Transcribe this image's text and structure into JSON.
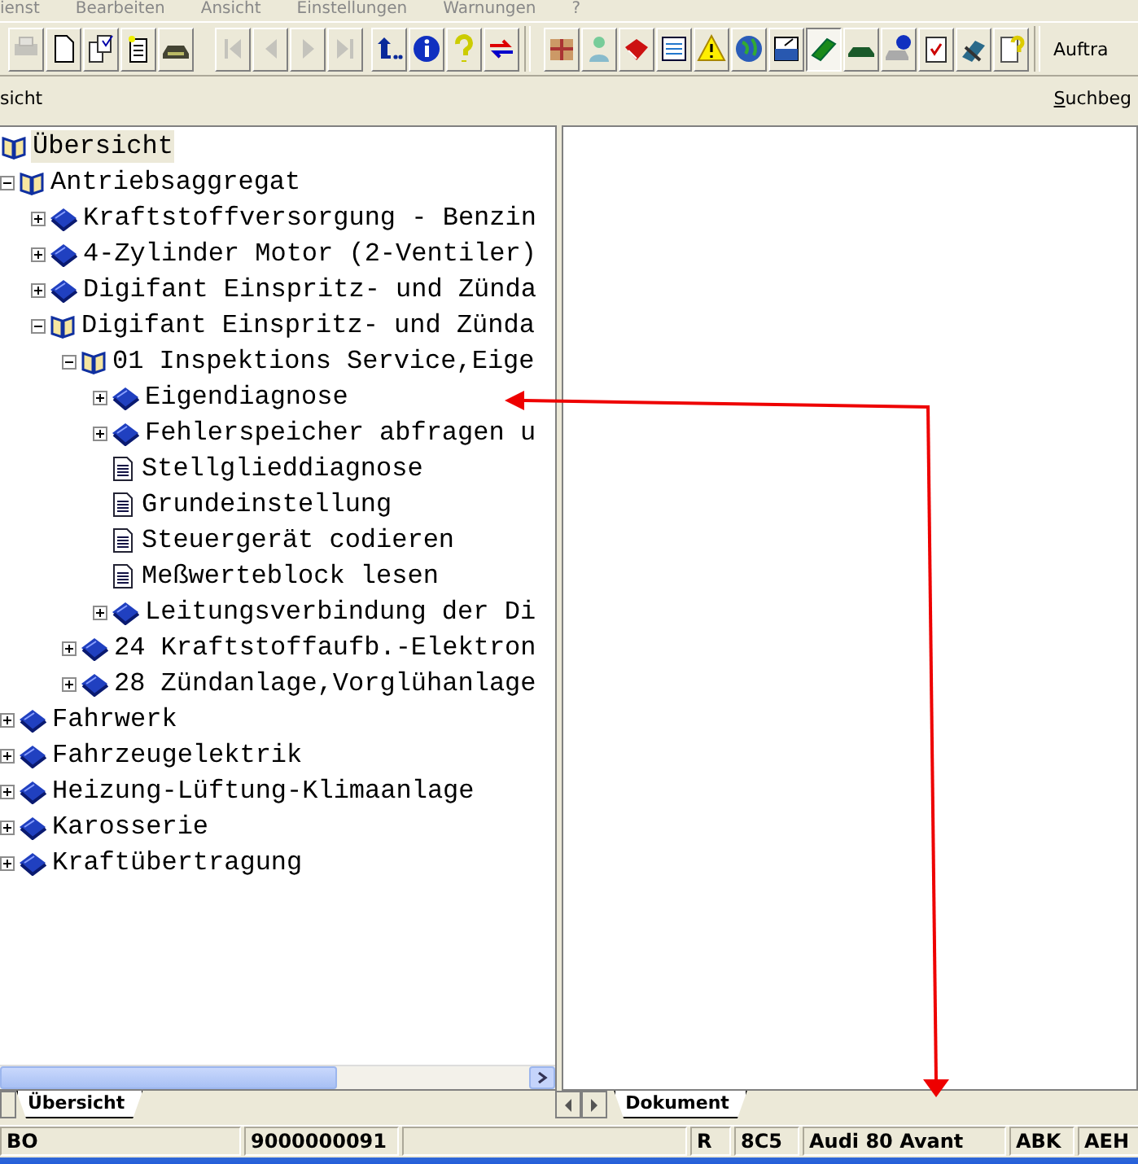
{
  "menu": [
    "ienst",
    "Bearbeiten",
    "Ansicht",
    "Einstellungen",
    "Warnungen",
    "?"
  ],
  "toolbar": {
    "groups": [
      [
        {
          "disabled": true,
          "pressed": false
        },
        {
          "disabled": false,
          "pressed": false
        },
        {
          "disabled": false,
          "pressed": false
        },
        {
          "disabled": false,
          "pressed": false
        },
        {
          "disabled": false,
          "pressed": false
        }
      ],
      [
        {
          "disabled": true,
          "pressed": false
        },
        {
          "disabled": true,
          "pressed": false
        },
        {
          "disabled": true,
          "pressed": false
        },
        {
          "disabled": true,
          "pressed": false
        }
      ],
      [
        {
          "disabled": false,
          "pressed": false
        },
        {
          "disabled": false,
          "pressed": false
        },
        {
          "disabled": false,
          "pressed": false
        },
        {
          "disabled": false,
          "pressed": false
        }
      ],
      [
        {
          "disabled": false,
          "pressed": false
        },
        {
          "disabled": false,
          "pressed": false
        },
        {
          "disabled": false,
          "pressed": false
        },
        {
          "disabled": false,
          "pressed": false
        },
        {
          "disabled": false,
          "pressed": false
        },
        {
          "disabled": false,
          "pressed": false
        },
        {
          "disabled": false,
          "pressed": false
        },
        {
          "disabled": false,
          "pressed": true
        },
        {
          "disabled": false,
          "pressed": false
        },
        {
          "disabled": false,
          "pressed": false
        },
        {
          "disabled": false,
          "pressed": false
        },
        {
          "disabled": false,
          "pressed": false
        },
        {
          "disabled": false,
          "pressed": false
        }
      ]
    ],
    "label": "Auftra"
  },
  "subbar": {
    "left": "sicht",
    "search_label": "Suchbeg"
  },
  "tree": [
    {
      "label": "Übersicht",
      "kind": "root",
      "selected": true
    },
    {
      "label": "Antriebsaggregat",
      "kind": "book",
      "expanded": true,
      "selected": false,
      "children": [
        {
          "label": "Kraftstoffversorgung - Benzin",
          "kind": "book",
          "expanded": false,
          "selected": false
        },
        {
          "label": "4-Zylinder Motor (2-Ventiler)",
          "kind": "book",
          "expanded": false,
          "selected": false
        },
        {
          "label": "Digifant Einspritz- und Zünda",
          "kind": "book",
          "expanded": false,
          "selected": false
        },
        {
          "label": "Digifant Einspritz- und Zünda",
          "kind": "book",
          "expanded": true,
          "selected": false,
          "children": [
            {
              "label": "01 Inspektions Service,Eige",
              "kind": "book",
              "expanded": true,
              "selected": false,
              "children": [
                {
                  "label": "Eigendiagnose",
                  "kind": "book",
                  "expanded": false,
                  "selected": false
                },
                {
                  "label": "Fehlerspeicher abfragen u",
                  "kind": "book",
                  "expanded": false,
                  "selected": false
                },
                {
                  "label": "Stellglieddiagnose",
                  "kind": "page",
                  "selected": false
                },
                {
                  "label": "Grundeinstellung",
                  "kind": "page",
                  "selected": false
                },
                {
                  "label": "Steuergerät codieren",
                  "kind": "page",
                  "selected": false
                },
                {
                  "label": "Meßwerteblock lesen",
                  "kind": "page",
                  "selected": false
                },
                {
                  "label": "Leitungsverbindung der Di",
                  "kind": "book",
                  "expanded": false,
                  "selected": false
                }
              ]
            },
            {
              "label": "24 Kraftstoffaufb.-Elektron",
              "kind": "book",
              "expanded": false,
              "selected": false
            },
            {
              "label": "28 Zündanlage,Vorglühanlage",
              "kind": "book",
              "expanded": false,
              "selected": false
            }
          ]
        }
      ]
    },
    {
      "label": "Fahrwerk",
      "kind": "book",
      "expanded": false,
      "selected": false
    },
    {
      "label": "Fahrzeugelektrik",
      "kind": "book",
      "expanded": false,
      "selected": false
    },
    {
      "label": "Heizung-Lüftung-Klimaanlage",
      "kind": "book",
      "expanded": false,
      "selected": false
    },
    {
      "label": "Karosserie",
      "kind": "book",
      "expanded": false,
      "selected": false
    },
    {
      "label": "Kraftübertragung",
      "kind": "book",
      "expanded": false,
      "selected": false
    }
  ],
  "left_tabs": [
    {
      "label": "Übersicht",
      "selected": true
    }
  ],
  "right_tabs": [
    {
      "label": "Dokument",
      "selected": true
    }
  ],
  "status_bar": [
    "BO",
    "9000000091",
    "R",
    "8C5",
    "Audi 80 Avant",
    "ABK",
    "AEH"
  ]
}
